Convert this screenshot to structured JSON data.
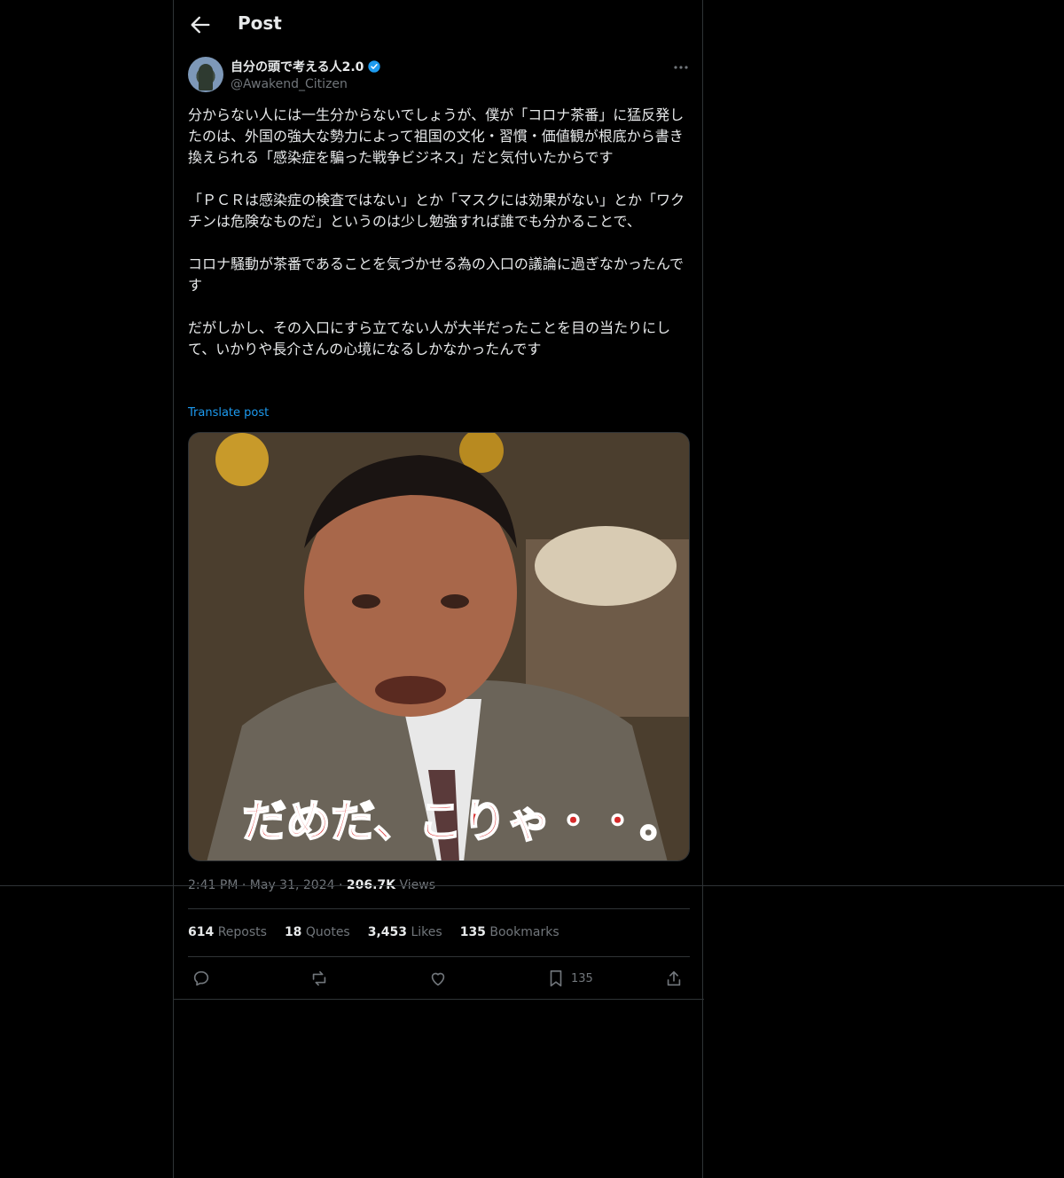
{
  "header": {
    "title": "Post"
  },
  "post": {
    "author_name": "自分の頭で考える人2.0",
    "author_handle": "@Awakend_Citizen",
    "paragraphs": [
      "分からない人には一生分からないでしょうが、僕が「コロナ茶番」に猛反発したのは、外国の強大な勢力によって祖国の文化・習慣・価値観が根底から書き換えられる「感染症を騙った戦争ビジネス」だと気付いたからです",
      "「ＰＣＲは感染症の検査ではない」とか「マスクには効果がない」とか「ワクチンは危険なものだ」というのは少し勉強すれば誰でも分かることで、",
      "コロナ騒動が茶番であることを気づかせる為の入口の議論に過ぎなかったんです",
      "だがしかし、その入口にすら立てない人が大半だったことを目の当たりにして、いかりや長介さんの心境になるしかなかったんです"
    ],
    "translate_label": "Translate post",
    "media_caption": "だめだ、こりゃ・・。",
    "time": "2:41 PM",
    "date": "May 31, 2024",
    "views_count": "206.7K",
    "views_label": "Views"
  },
  "stats": {
    "reposts_count": "614",
    "reposts_label": "Reposts",
    "quotes_count": "18",
    "quotes_label": "Quotes",
    "likes_count": "3,453",
    "likes_label": "Likes",
    "bookmarks_count": "135",
    "bookmarks_label": "Bookmarks"
  },
  "actions": {
    "bookmark_count": "135"
  },
  "colors": {
    "background": "#000000",
    "text": "#e7e9ea",
    "muted": "#71767b",
    "accent": "#1d9bf0",
    "border": "#2f3336"
  },
  "icons": [
    "back-arrow-icon",
    "verified-badge-icon",
    "more-icon",
    "reply-icon",
    "repost-icon",
    "like-icon",
    "bookmark-icon",
    "share-icon"
  ]
}
